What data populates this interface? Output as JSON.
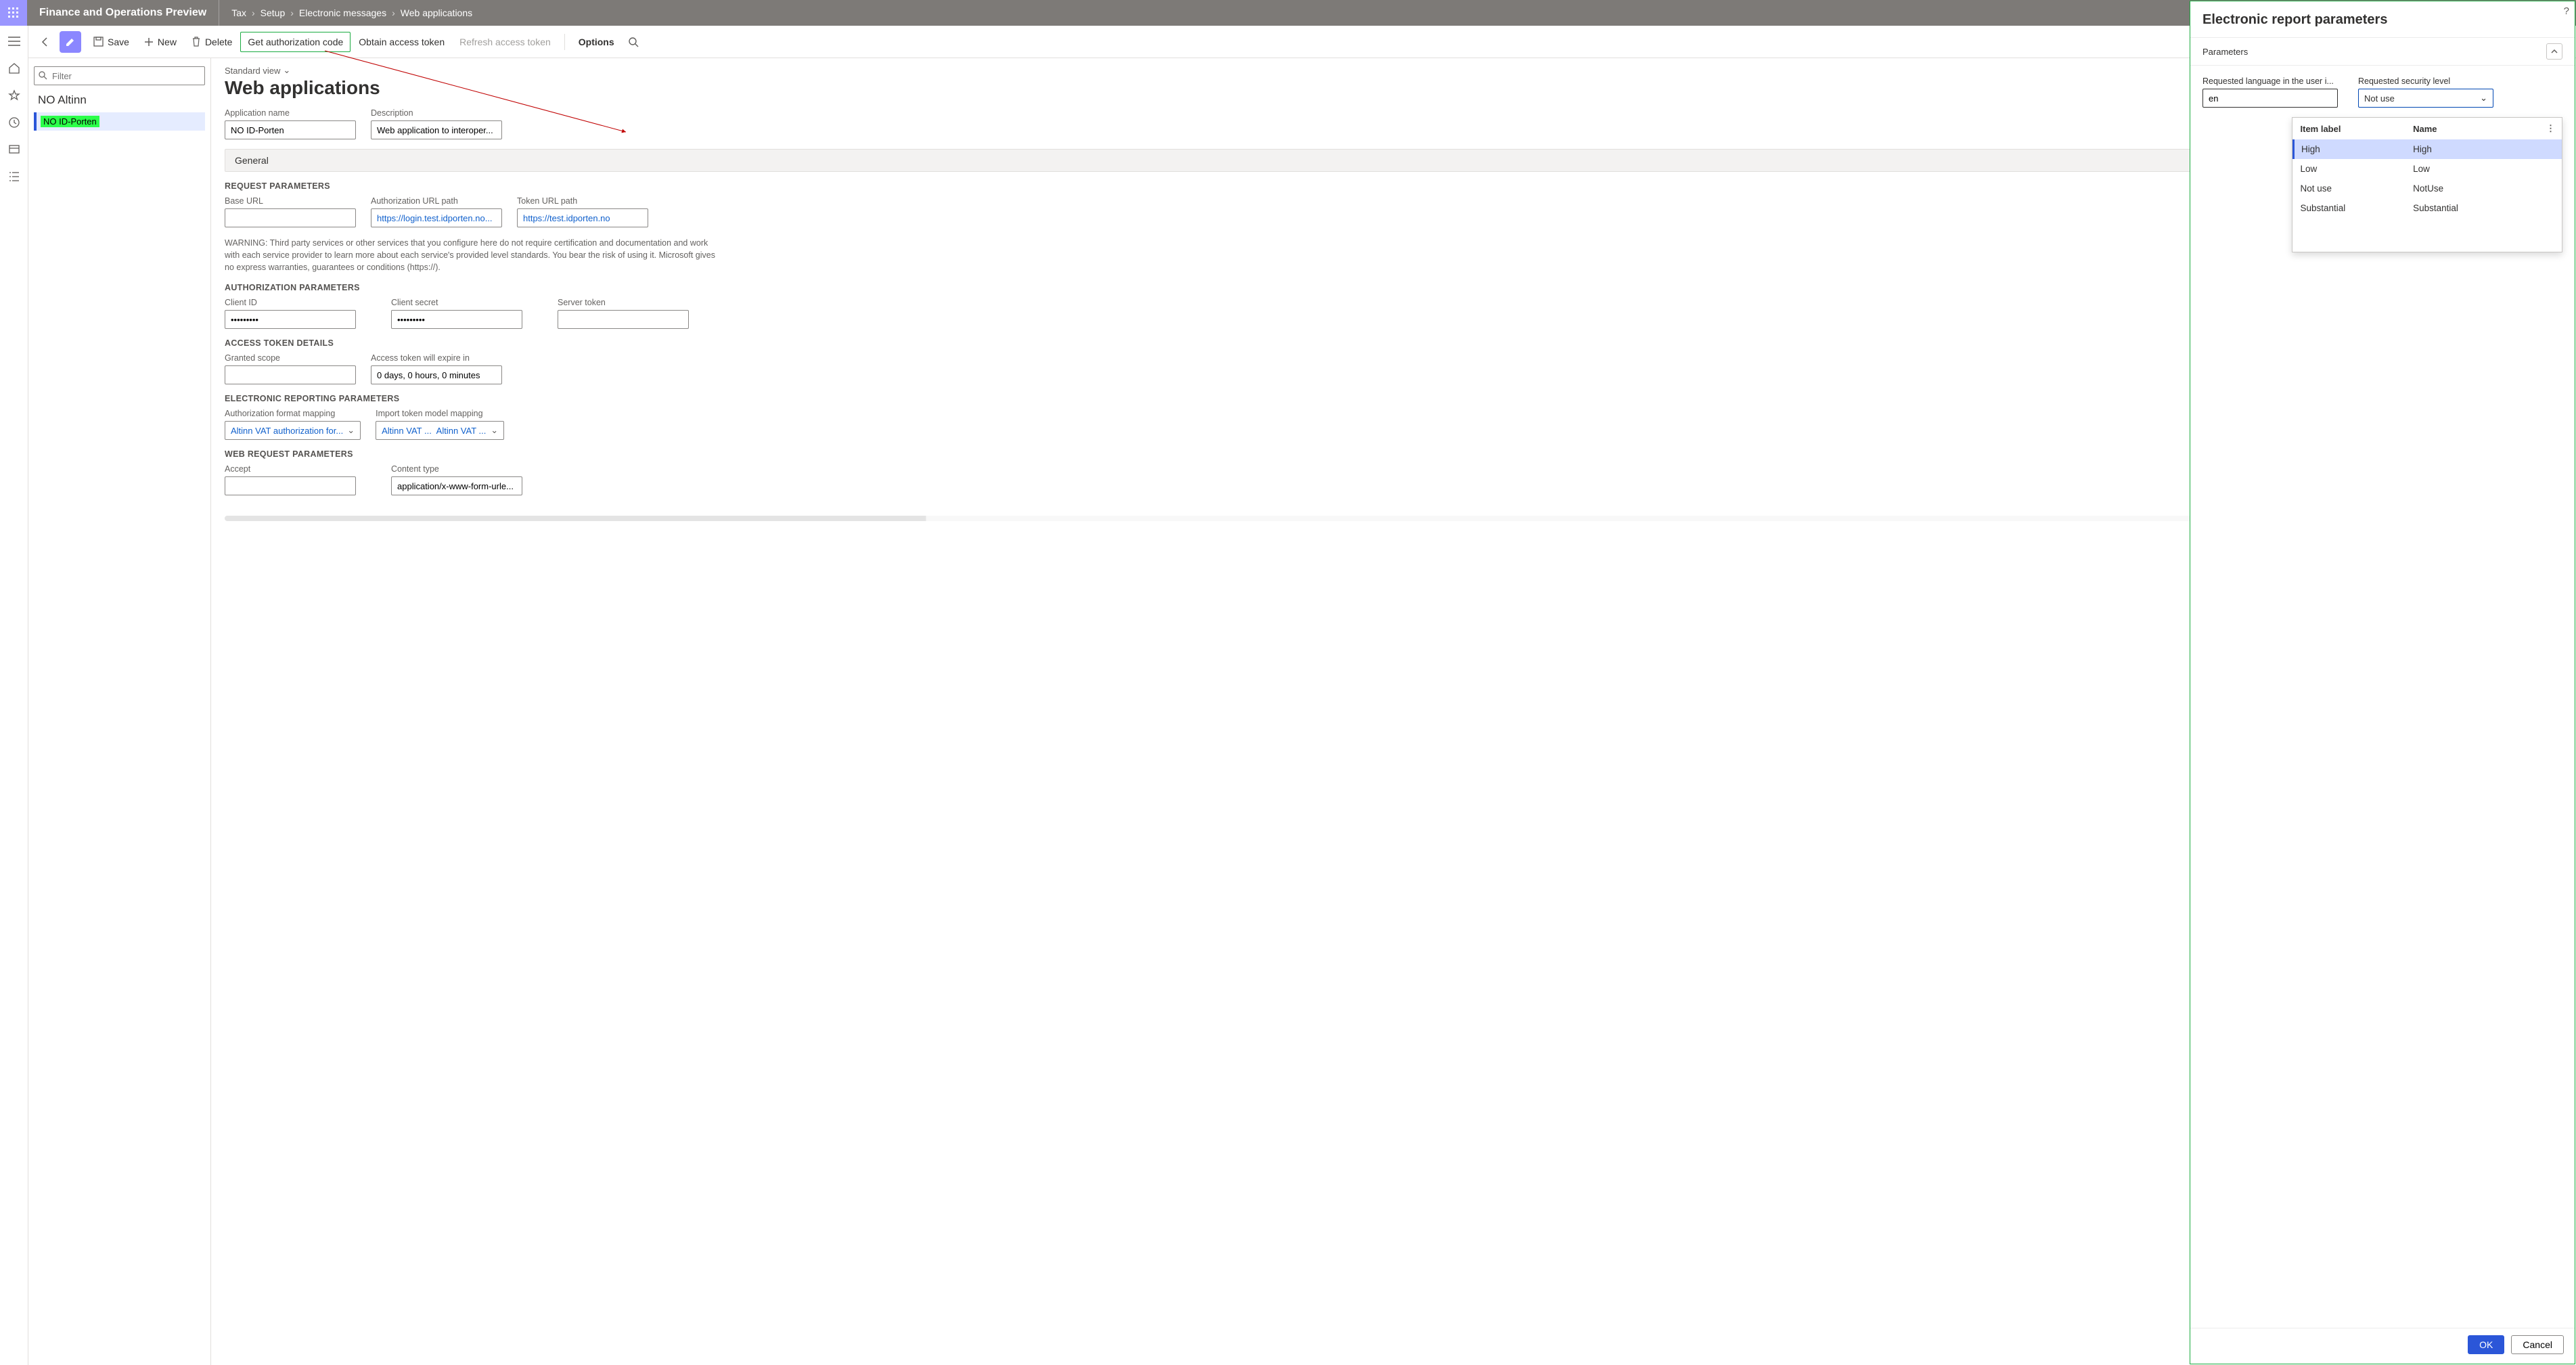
{
  "app_title": "Finance and Operations Preview",
  "breadcrumb": [
    "Tax",
    "Setup",
    "Electronic messages",
    "Web applications"
  ],
  "toolbar": {
    "save": "Save",
    "new": "New",
    "delete": "Delete",
    "get_auth": "Get authorization code",
    "obtain_token": "Obtain access token",
    "refresh_token": "Refresh access token",
    "options": "Options"
  },
  "list": {
    "filter_placeholder": "Filter",
    "heading": "NO Altinn",
    "selected_item": "NO ID-Porten"
  },
  "form": {
    "view_label": "Standard view",
    "title": "Web applications",
    "app_name_label": "Application name",
    "app_name_value": "NO ID-Porten",
    "description_label": "Description",
    "description_value": "Web application to interoper...",
    "general_tab": "General",
    "request_params": "REQUEST PARAMETERS",
    "base_url_label": "Base URL",
    "base_url_value": "",
    "auth_url_label": "Authorization URL path",
    "auth_url_value": "https://login.test.idporten.no...",
    "token_url_label": "Token URL path",
    "token_url_value": "https://test.idporten.no",
    "warning": "WARNING: Third party services or other services that you configure here do not require certification and documentation and work with each service provider to learn more about each service's provided level standards. You bear the risk of using it. Microsoft gives no express warranties, guarantees or conditions (https://).",
    "auth_params": "AUTHORIZATION PARAMETERS",
    "client_id_label": "Client ID",
    "client_id_value": "•••••••••",
    "client_secret_label": "Client secret",
    "client_secret_value": "•••••••••",
    "server_token_label": "Server token",
    "server_token_value": "",
    "access_token": "ACCESS TOKEN DETAILS",
    "granted_scope_label": "Granted scope",
    "granted_scope_value": "",
    "expire_label": "Access token will expire in",
    "expire_value": "0 days, 0 hours, 0 minutes",
    "er_params": "ELECTRONIC REPORTING PARAMETERS",
    "auth_format_label": "Authorization format mapping",
    "auth_format_value": "Altinn VAT authorization for...",
    "import_token_label": "Import token model mapping",
    "import_token_value_a": "Altinn VAT ...",
    "import_token_value_b": "Altinn VAT ...",
    "web_req": "WEB REQUEST PARAMETERS",
    "accept_label": "Accept",
    "accept_value": "",
    "ctype_label": "Content type",
    "ctype_value": "application/x-www-form-urle..."
  },
  "dialog": {
    "title": "Electronic report parameters",
    "section": "Parameters",
    "lang_label": "Requested language in the user i...",
    "lang_value": "en",
    "sec_label": "Requested security level",
    "sec_value": "Not use",
    "dd_cols": {
      "item": "Item label",
      "name": "Name"
    },
    "dd_rows": [
      {
        "label": "High",
        "name": "High",
        "selected": true
      },
      {
        "label": "Low",
        "name": "Low"
      },
      {
        "label": "Not use",
        "name": "NotUse"
      },
      {
        "label": "Substantial",
        "name": "Substantial"
      }
    ],
    "ok": "OK",
    "cancel": "Cancel"
  }
}
